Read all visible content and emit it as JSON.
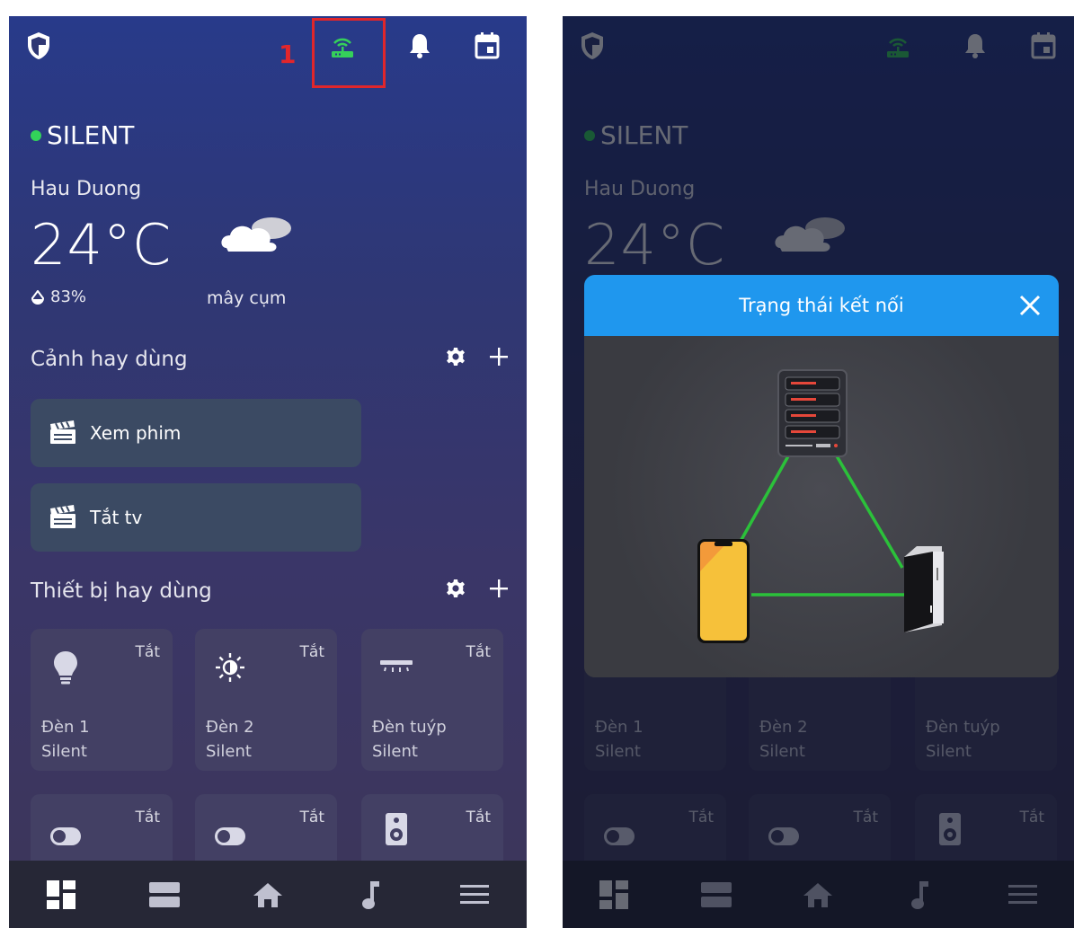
{
  "annotation": {
    "marker": "1"
  },
  "status": {
    "mode": "SILENT"
  },
  "weather": {
    "location": "Hau Duong",
    "temperature": "24°C",
    "humidity": "83%",
    "description": "mây cụm"
  },
  "scenes": {
    "title": "Cảnh hay dùng",
    "items": [
      {
        "label": "Xem phim"
      },
      {
        "label": "Tắt tv"
      }
    ]
  },
  "devices": {
    "title": "Thiết bị hay dùng",
    "items": [
      {
        "icon": "bulb-icon",
        "state": "Tắt",
        "name": "Đèn 1",
        "room": "Silent"
      },
      {
        "icon": "brightness-icon",
        "state": "Tắt",
        "name": "Đèn 2",
        "room": "Silent"
      },
      {
        "icon": "tube-light-icon",
        "state": "Tắt",
        "name": "Đèn tuýp",
        "room": "Silent"
      },
      {
        "icon": "toggle-icon",
        "state": "Tắt"
      },
      {
        "icon": "toggle-icon",
        "state": "Tắt"
      },
      {
        "icon": "speaker-icon",
        "state": "Tắt"
      }
    ]
  },
  "dialog": {
    "title": "Trạng thái kết nối"
  },
  "colors": {
    "accent": "#1f97ee",
    "online": "#32d35a",
    "connection_line": "#2bc13a",
    "highlight": "#e0262b"
  }
}
